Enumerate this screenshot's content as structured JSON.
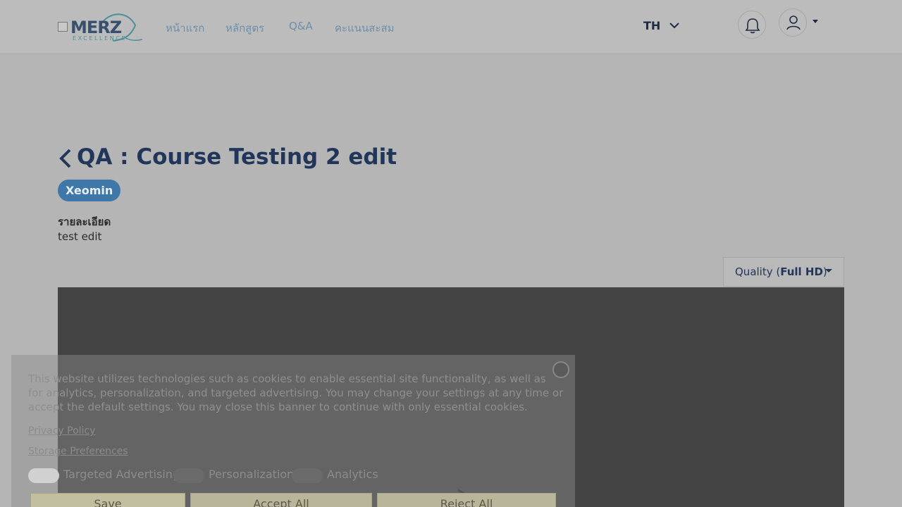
{
  "header": {
    "logo": {
      "word": "MERZ",
      "sub": "EXCELLENCE",
      "icon": "merz-logo"
    },
    "nav": [
      {
        "label": "หน้าแรก"
      },
      {
        "label": "หลักสูตร"
      },
      {
        "label": "Q&A"
      },
      {
        "label": "คะแนนสะสม"
      }
    ],
    "language": "TH",
    "language_icon": "chevron-down-icon",
    "notification_icon": "bell-icon",
    "user_icon": "user-icon"
  },
  "page": {
    "title": "QA : Course Testing 2 edit",
    "tag": "Xeomin",
    "detail_label": "รายละเอียด",
    "detail_value": "test edit"
  },
  "video": {
    "quality_prefix": "Quality (",
    "quality_value": "Full HD",
    "quality_suffix": ")"
  },
  "cookie_banner": {
    "text": "This website utilizes technologies such as cookies to enable essential site functionality, as well as for analytics, personalization, and targeted advertising. You may change your settings at any time or accept the default settings. You may close this banner to continue with only essential cookies.",
    "privacy_link": "Privacy Policy",
    "storage_link": "Storage Preferences",
    "toggles": [
      {
        "label": "Targeted Advertising",
        "on": true
      },
      {
        "label": "Personalization",
        "on": false
      },
      {
        "label": "Analytics",
        "on": false
      }
    ],
    "buttons": {
      "save": "Save",
      "accept": "Accept All",
      "reject": "Reject All"
    }
  }
}
